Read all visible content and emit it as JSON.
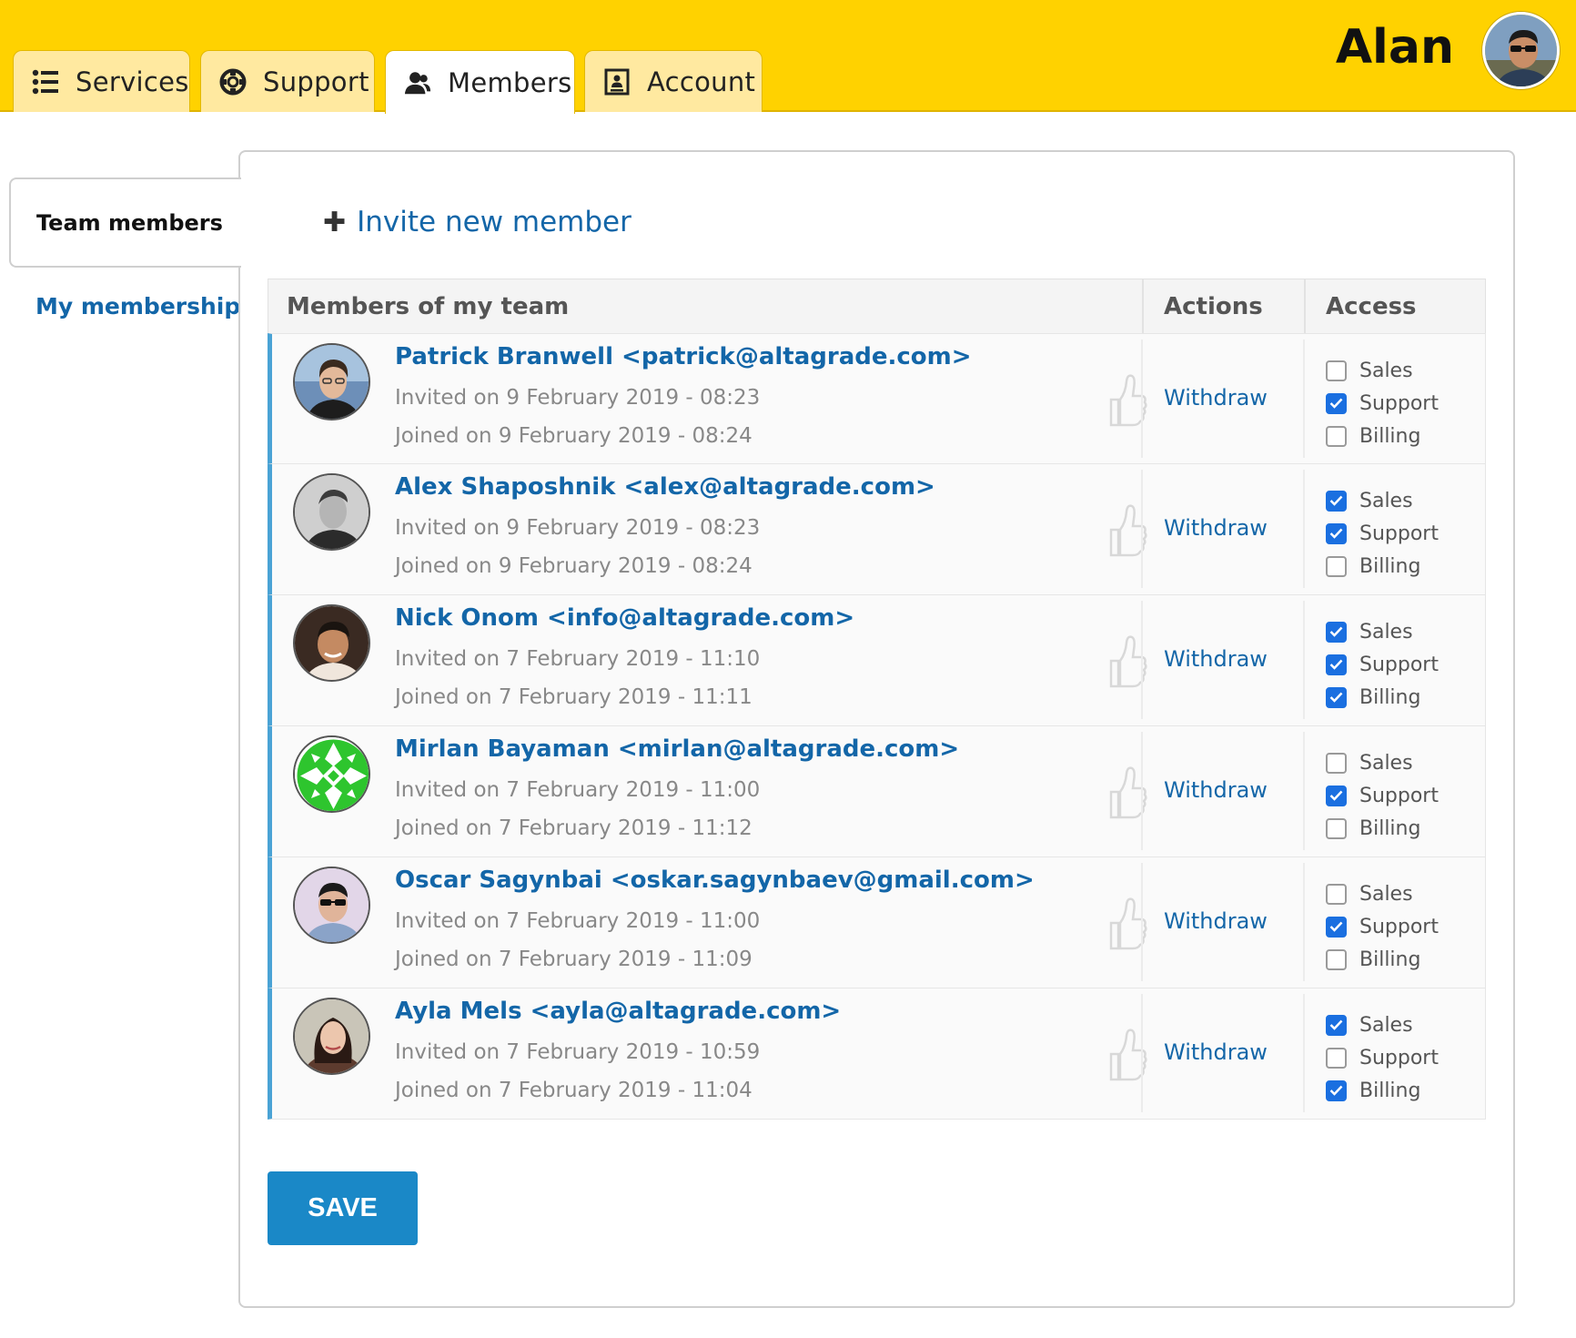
{
  "tabs": [
    {
      "label": "Services",
      "icon": "list-icon"
    },
    {
      "label": "Support",
      "icon": "lifebuoy-icon"
    },
    {
      "label": "Members",
      "icon": "users-icon"
    },
    {
      "label": "Account",
      "icon": "id-card-icon"
    }
  ],
  "user": {
    "name": "Alan"
  },
  "sidebar": {
    "active": "Team members",
    "link": "My memberships"
  },
  "invite": {
    "label": "Invite new member"
  },
  "table": {
    "headers": {
      "members": "Members of my team",
      "actions": "Actions",
      "access": "Access"
    },
    "rows": [
      {
        "name": "Patrick Branwell <patrick@altagrade.com>",
        "invited": "Invited on 9 February 2019 - 08:23",
        "joined": "Joined on 9 February 2019 - 08:24",
        "action": "Withdraw",
        "access": [
          {
            "label": "Sales",
            "checked": false
          },
          {
            "label": "Support",
            "checked": true
          },
          {
            "label": "Billing",
            "checked": false
          }
        ]
      },
      {
        "name": "Alex Shaposhnik <alex@altagrade.com>",
        "invited": "Invited on 9 February 2019 - 08:23",
        "joined": "Joined on 9 February 2019 - 08:24",
        "action": "Withdraw",
        "access": [
          {
            "label": "Sales",
            "checked": true
          },
          {
            "label": "Support",
            "checked": true
          },
          {
            "label": "Billing",
            "checked": false
          }
        ]
      },
      {
        "name": "Nick Onom <info@altagrade.com>",
        "invited": "Invited on 7 February 2019 - 11:10",
        "joined": "Joined on 7 February 2019 - 11:11",
        "action": "Withdraw",
        "access": [
          {
            "label": "Sales",
            "checked": true
          },
          {
            "label": "Support",
            "checked": true
          },
          {
            "label": "Billing",
            "checked": true
          }
        ]
      },
      {
        "name": "Mirlan Bayaman <mirlan@altagrade.com>",
        "invited": "Invited on 7 February 2019 - 11:00",
        "joined": "Joined on 7 February 2019 - 11:12",
        "action": "Withdraw",
        "access": [
          {
            "label": "Sales",
            "checked": false
          },
          {
            "label": "Support",
            "checked": true
          },
          {
            "label": "Billing",
            "checked": false
          }
        ]
      },
      {
        "name": "Oscar Sagynbai <oskar.sagynbaev@gmail.com>",
        "invited": "Invited on 7 February 2019 - 11:00",
        "joined": "Joined on 7 February 2019 - 11:09",
        "action": "Withdraw",
        "access": [
          {
            "label": "Sales",
            "checked": false
          },
          {
            "label": "Support",
            "checked": true
          },
          {
            "label": "Billing",
            "checked": false
          }
        ]
      },
      {
        "name": "Ayla Mels <ayla@altagrade.com>",
        "invited": "Invited on 7 February 2019 - 10:59",
        "joined": "Joined on 7 February 2019 - 11:04",
        "action": "Withdraw",
        "access": [
          {
            "label": "Sales",
            "checked": true
          },
          {
            "label": "Support",
            "checked": false
          },
          {
            "label": "Billing",
            "checked": true
          }
        ]
      }
    ]
  },
  "save": {
    "label": "SAVE"
  },
  "colors": {
    "brand_yellow": "#ffd200",
    "link_blue": "#1366a8",
    "accent_blue": "#1a88c7",
    "checkbox_blue": "#1a6fe0"
  }
}
